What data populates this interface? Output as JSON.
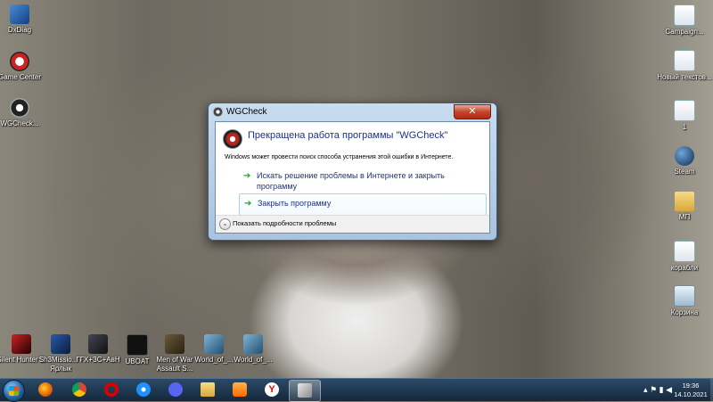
{
  "desktop": {
    "left_icons": [
      {
        "label": "DxDiag",
        "icon": "dxdiag-icon"
      },
      {
        "label": "Game Center",
        "icon": "game-center-icon"
      },
      {
        "label": "WGCheck...",
        "icon": "wgcheck-icon"
      }
    ],
    "right_icons": [
      {
        "label": "Campaign...",
        "icon": "text-file-icon"
      },
      {
        "label": "Новый текстов...",
        "icon": "text-file-icon"
      },
      {
        "label": "1",
        "icon": "text-file-icon"
      },
      {
        "label": "Steam",
        "icon": "steam-icon"
      },
      {
        "label": "МП",
        "icon": "folder-icon"
      },
      {
        "label": "корабли",
        "icon": "text-file-icon"
      },
      {
        "label": "Корзина",
        "icon": "recycle-bin-icon"
      }
    ],
    "bottom_icons": [
      {
        "label": "Silent Hunter III",
        "icon": "silent-hunter-icon"
      },
      {
        "label": "Sh3Missio... - Ярлык",
        "icon": "sh3-mission-icon"
      },
      {
        "label": "ГГХ+ЗС+АвН",
        "icon": "shortcut-icon"
      },
      {
        "label": "UBOAT",
        "icon": "uboat-icon"
      },
      {
        "label": "Men of War Assault S...",
        "icon": "men-of-war-icon"
      },
      {
        "label": "World_of_...",
        "icon": "wot-icon"
      },
      {
        "label": "World_of_...",
        "icon": "wot-icon"
      }
    ]
  },
  "dialog": {
    "title": "WGCheck",
    "close_glyph": "✕",
    "headline": "Прекращена работа программы \"WGCheck\"",
    "message": "Windows может провести поиск способа устранения этой ошибки в Интернете.",
    "option1": "Искать решение проблемы в Интернете и закрыть программу",
    "option2": "Закрыть программу",
    "arrow_glyph": "➔",
    "details_chevron": "⌄",
    "details_label": "Показать подробности проблемы"
  },
  "taskbar": {
    "apps": [
      "firefox-icon",
      "chrome-icon",
      "opera-icon",
      "ie-icon",
      "discord-icon",
      "explorer-icon",
      "media-player-icon",
      "yandex-icon",
      "wgcheck-task-icon"
    ],
    "yandex_letter": "Y",
    "tray_glyphs": "▴ ⚑ ▮ ◀",
    "time": "19:36",
    "date": "14.10.2021"
  }
}
